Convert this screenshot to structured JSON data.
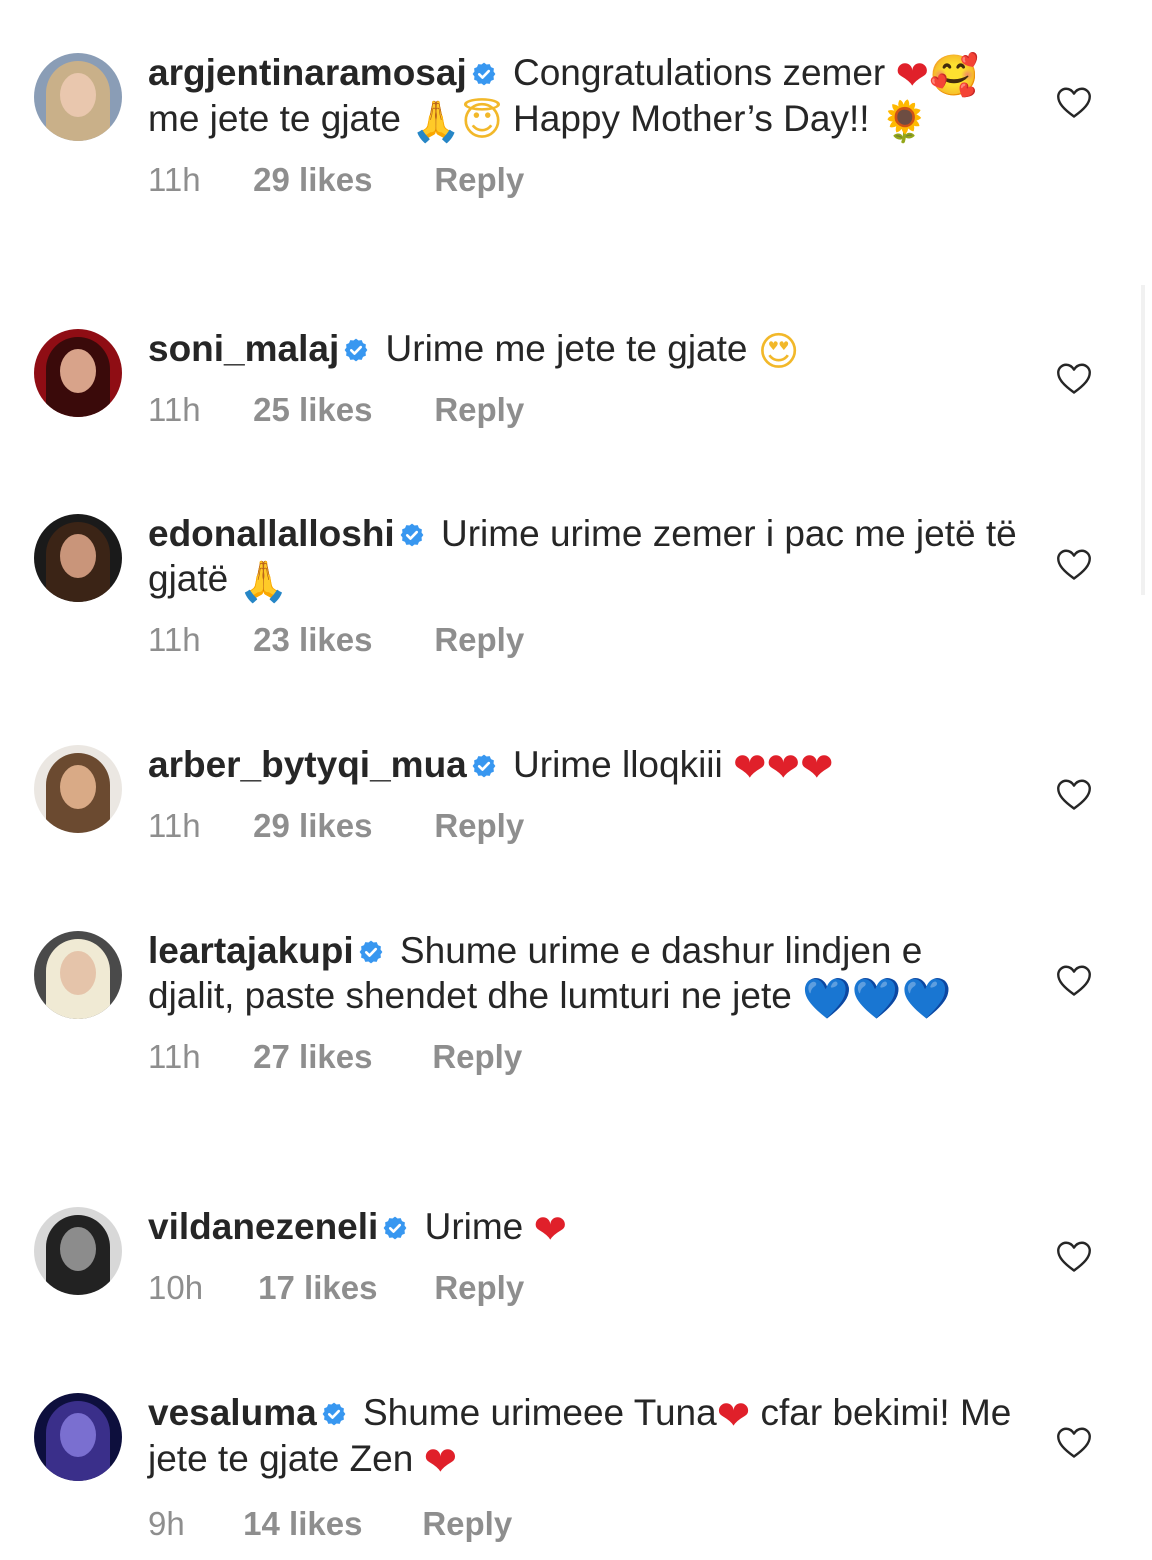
{
  "comments": [
    {
      "username": "argjentinaramosaj",
      "verified": true,
      "text": "Congratulations zemer ❤️🥰me jete te gjate 🙏🏼😇 Happy Mother’s Day!! 🌻",
      "time": "11h",
      "likes": "29 likes",
      "reply": "Reply",
      "avatar_colors": {
        "bg": "#8a9db6",
        "hair": "#c9b089",
        "face": "#e9c7ae"
      }
    },
    {
      "username": "soni_malaj",
      "verified": true,
      "text": "Urime me jete te gjate 😍",
      "time": "11h",
      "likes": "25 likes",
      "reply": "Reply",
      "avatar_colors": {
        "bg": "#8f0d14",
        "hair": "#3a0a0a",
        "face": "#d8a38a"
      }
    },
    {
      "username": "edonallalloshi",
      "verified": true,
      "text": "Urime urime zemer i pac me jetë të gjatë 🙏",
      "time": "11h",
      "likes": "23 likes",
      "reply": "Reply",
      "avatar_colors": {
        "bg": "#1a1a1a",
        "hair": "#3b2416",
        "face": "#c9957a"
      }
    },
    {
      "username": "arber_bytyqi_mua",
      "verified": true,
      "text": "Urime lloqkiii ❤️❤️❤️",
      "time": "11h",
      "likes": "29 likes",
      "reply": "Reply",
      "avatar_colors": {
        "bg": "#ebe7e2",
        "hair": "#6b4a30",
        "face": "#d9aa86"
      }
    },
    {
      "username": "leartajakupi",
      "verified": true,
      "text": "Shume urime e dashur lindjen e djalit, paste shendet dhe lumturi ne jete 💙💙💙",
      "time": "11h",
      "likes": "27 likes",
      "reply": "Reply",
      "avatar_colors": {
        "bg": "#4a4a4a",
        "hair": "#f0ead4",
        "face": "#e5c4aa"
      }
    },
    {
      "username": "vildanezeneli",
      "verified": true,
      "text": "Urime ❤️",
      "time": "10h",
      "likes": "17 likes",
      "reply": "Reply",
      "avatar_colors": {
        "bg": "#d8d8d8",
        "hair": "#222222",
        "face": "#8c8c8c"
      }
    },
    {
      "username": "vesaluma",
      "verified": true,
      "text": "Shume urimeee Tuna❤️ cfar bekimi! Me jete te gjate Zen ❤️",
      "time": "9h",
      "likes": "14 likes",
      "reply": "Reply",
      "avatar_colors": {
        "bg": "#0d0f3d",
        "hair": "#3a2f8a",
        "face": "#7a6fd0"
      }
    }
  ],
  "colors": {
    "verified_blue": "#3897f0",
    "meta_gray": "#8e8e8e",
    "text": "#262626",
    "heart_outline": "#262626"
  },
  "icons": {
    "verified": "verified-badge-icon",
    "like": "heart-outline-icon"
  }
}
